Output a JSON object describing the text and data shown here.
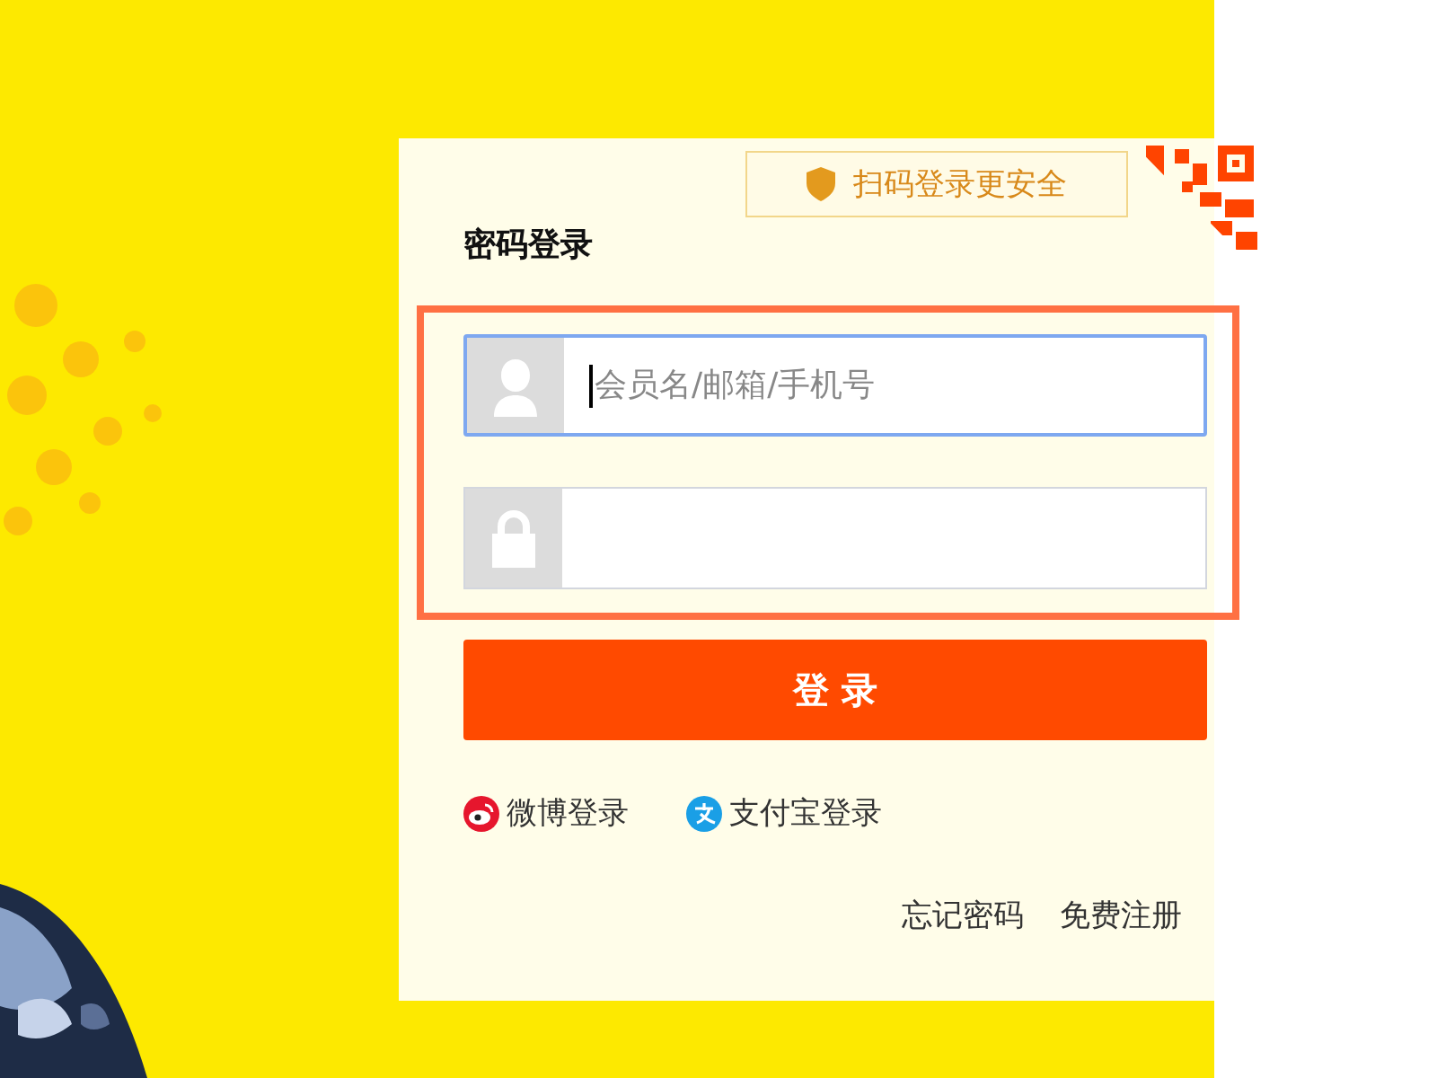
{
  "qr_tip": {
    "text": "扫码登录更安全"
  },
  "title": "密码登录",
  "annotation": {
    "kind": "frame"
  },
  "fields": [
    {
      "kind": "user",
      "placeholder": "会员名/邮箱/手机号",
      "focused": true
    },
    {
      "kind": "password",
      "focused": false
    }
  ],
  "login_button": "登 录",
  "social_logins": [
    {
      "kind": "weibo",
      "label": "微博登录"
    },
    {
      "kind": "alipay",
      "label": "支付宝登录"
    }
  ],
  "links": [
    "忘记密码",
    "免费注册"
  ]
}
